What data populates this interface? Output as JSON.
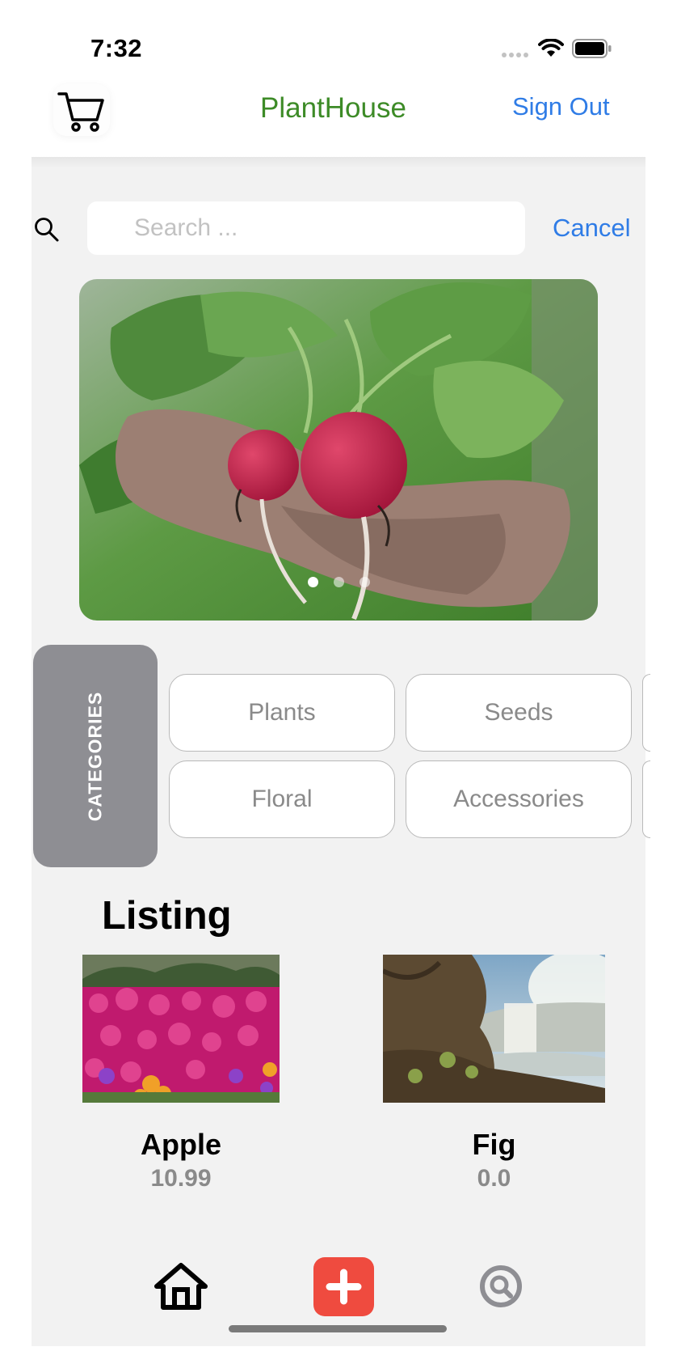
{
  "status_bar": {
    "time": "7:32"
  },
  "nav": {
    "title": "PlantHouse",
    "sign_out_label": "Sign Out",
    "cart_icon": "cart-icon"
  },
  "search": {
    "placeholder": "Search ...",
    "value": "",
    "cancel_label": "Cancel"
  },
  "carousel": {
    "image_description": "hand holding radishes",
    "slide_count": 3,
    "active_slide": 1
  },
  "categories": {
    "label": "CATEGORIES",
    "items": [
      "Plants",
      "Seeds",
      "Floral",
      "Accessories"
    ]
  },
  "listing": {
    "heading": "Listing",
    "items": [
      {
        "name": "Apple",
        "price": "10.99"
      },
      {
        "name": "Fig",
        "price": "0.0"
      }
    ]
  },
  "tab_bar": {
    "items": [
      "home-icon",
      "add-icon",
      "search-icon"
    ],
    "active": "home-icon"
  },
  "colors": {
    "brand_green": "#3d8b27",
    "link_blue": "#2f7ce6",
    "add_red": "#ef4b3f",
    "category_gray": "#8e8e93",
    "content_bg": "#f2f2f2"
  }
}
